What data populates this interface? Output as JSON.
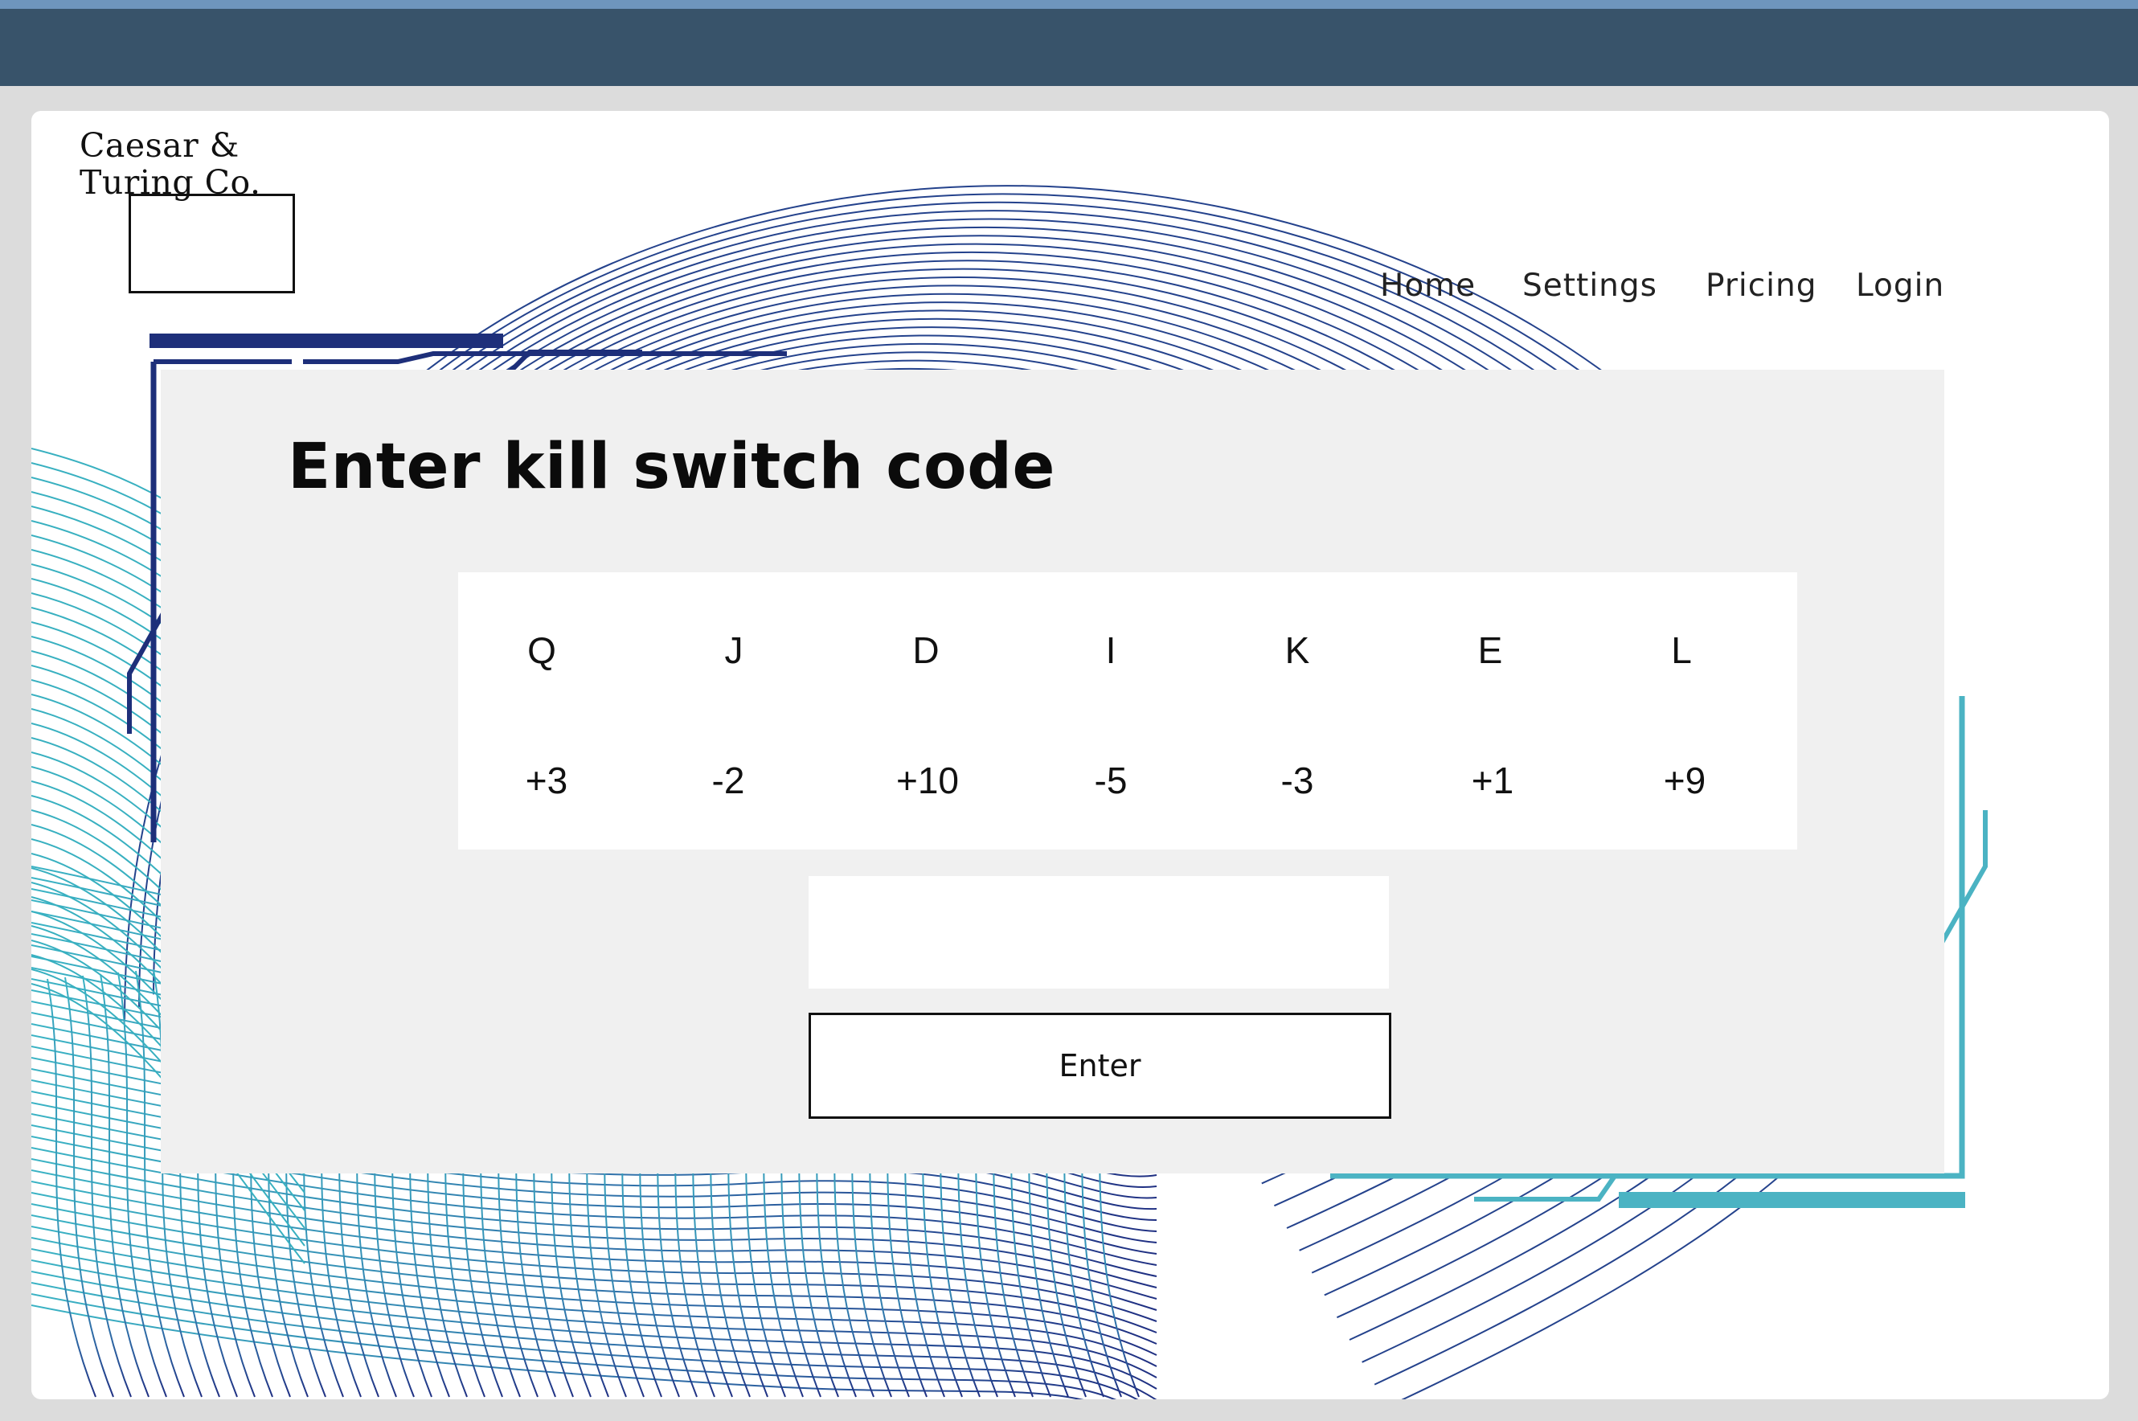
{
  "logo": {
    "text": "Caesar &\nTuring Co."
  },
  "nav": {
    "items": [
      {
        "id": "home",
        "label": "Home"
      },
      {
        "id": "settings",
        "label": "Settings"
      },
      {
        "id": "pricing",
        "label": "Pricing"
      },
      {
        "id": "login",
        "label": "Login"
      }
    ]
  },
  "main": {
    "title": "Enter kill switch code",
    "cipher": {
      "letters": [
        "Q",
        "J",
        "D",
        "I",
        "K",
        "E",
        "L"
      ],
      "shifts": [
        "+3",
        "-2",
        "+10",
        "-5",
        "-3",
        "+1",
        "+9"
      ]
    },
    "code_input": {
      "value": "",
      "placeholder": ""
    },
    "enter_label": "Enter"
  },
  "colors": {
    "browser_bar": "#38536a",
    "browser_bar_edge": "#6e95bd",
    "accent_navy": "#1e2f7a",
    "accent_teal": "#4bb3c3",
    "panel": "#f0f0f0"
  }
}
